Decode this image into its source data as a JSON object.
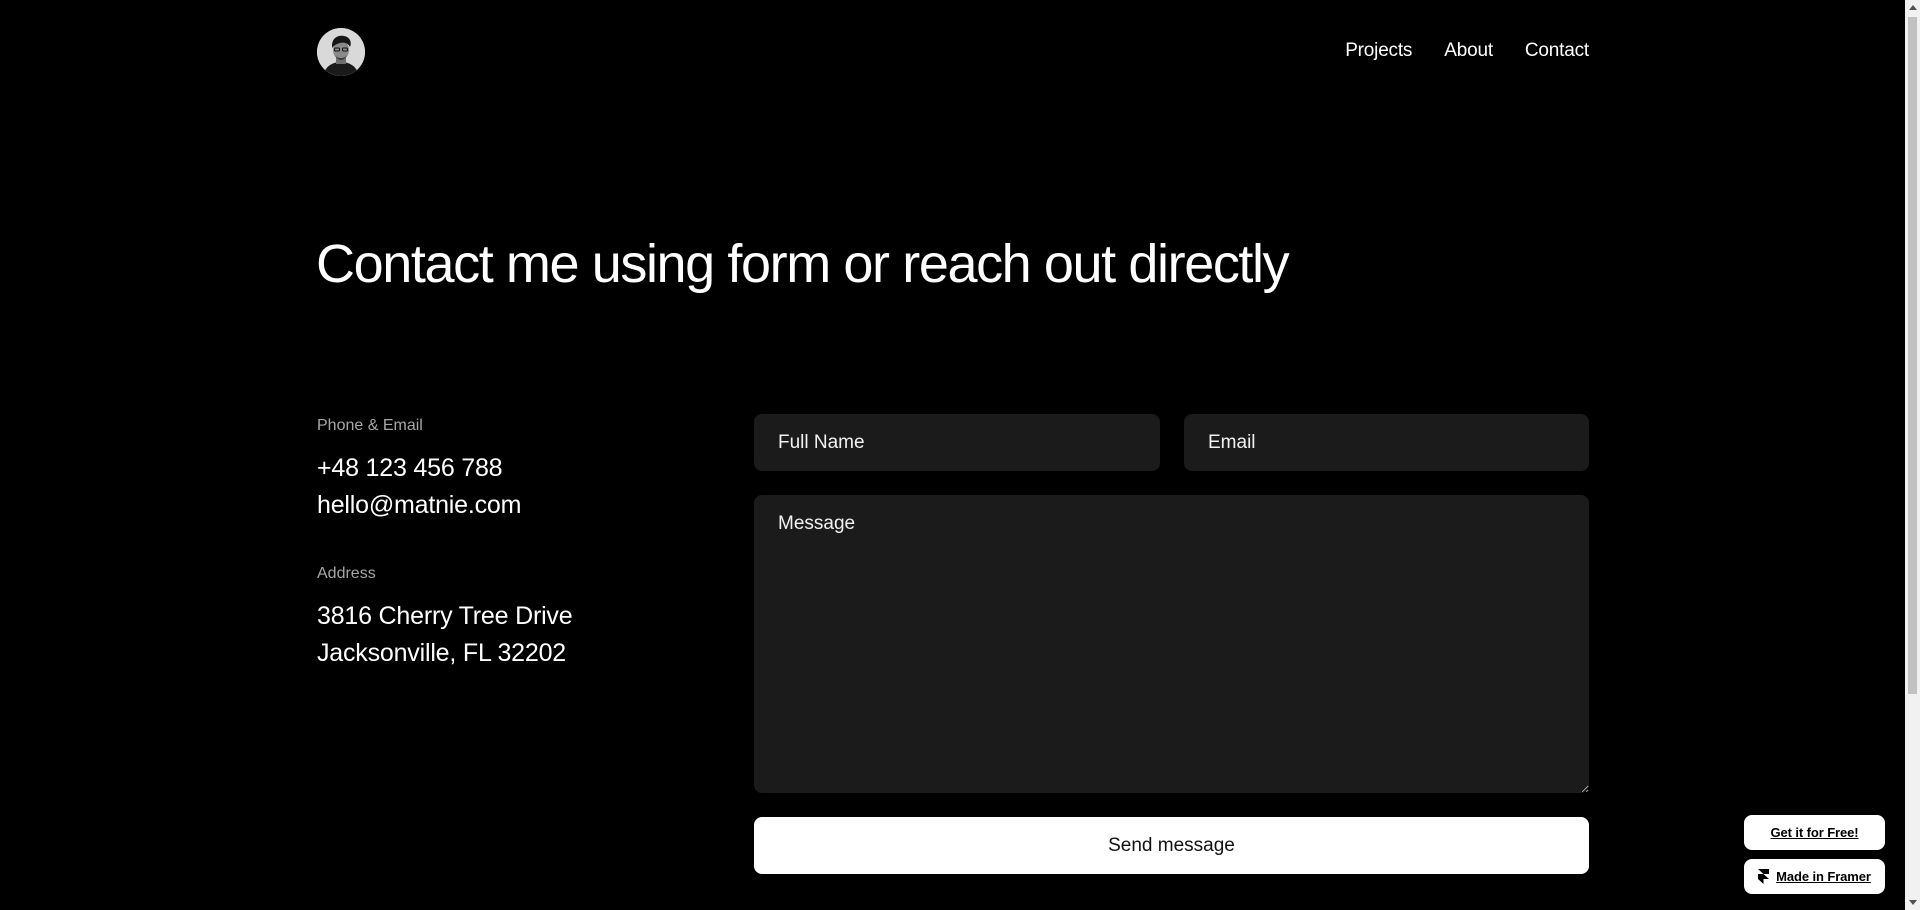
{
  "header": {
    "nav": [
      {
        "label": "Projects"
      },
      {
        "label": "About"
      },
      {
        "label": "Contact"
      }
    ]
  },
  "hero": {
    "title": "Contact me using form or reach out directly"
  },
  "info": {
    "phone_email_label": "Phone & Email",
    "phone": "+48 123 456 788",
    "email": "hello@matnie.com",
    "address_label": "Address",
    "street": "3816 Cherry Tree Drive",
    "city": "Jacksonville, FL 32202"
  },
  "form": {
    "name_placeholder": "Full Name",
    "email_placeholder": "Email",
    "message_placeholder": "Message",
    "submit_label": "Send message"
  },
  "badges": {
    "free_label": "Get it for Free!",
    "framer_label": "Made in Framer",
    "framer_icon": "framer-logo-icon"
  },
  "colors": {
    "background": "#000000",
    "field_bg": "#1b1b1b",
    "label_muted": "#a6a6a6",
    "button_bg": "#ffffff"
  }
}
